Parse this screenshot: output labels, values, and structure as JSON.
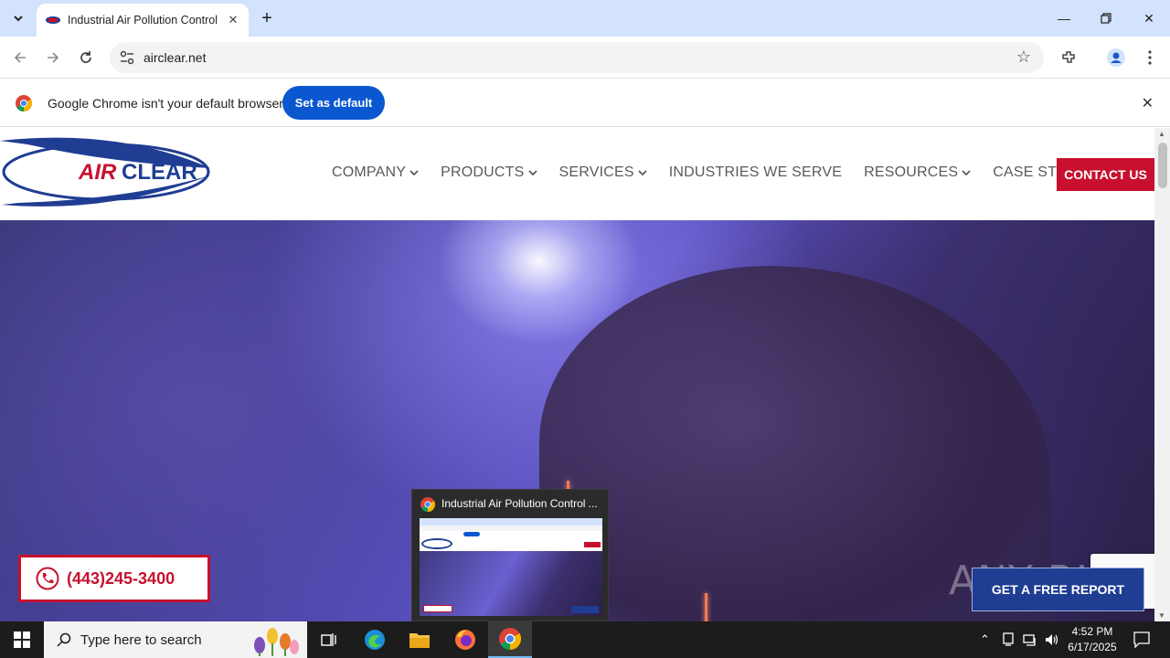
{
  "browser": {
    "tab_title": "Industrial Air Pollution Control",
    "url": "airclear.net"
  },
  "infobar": {
    "message": "Google Chrome isn't your default browser",
    "button": "Set as default"
  },
  "site": {
    "logo_text_air": "AIR",
    "logo_text_clear": "CLEAR",
    "nav": [
      {
        "label": "COMPANY",
        "dropdown": true
      },
      {
        "label": "PRODUCTS",
        "dropdown": true
      },
      {
        "label": "SERVICES",
        "dropdown": true
      },
      {
        "label": "INDUSTRIES WE SERVE",
        "dropdown": false
      },
      {
        "label": "RESOURCES",
        "dropdown": true
      },
      {
        "label": "CASE STUDIES",
        "dropdown": false
      }
    ],
    "contact_button": "CONTACT US",
    "phone": "(443)245-3400",
    "free_report_button": "GET A FREE REPORT",
    "watermark": "ANY RUN"
  },
  "preview": {
    "title": "Industrial Air Pollution Control ..."
  },
  "taskbar": {
    "search_placeholder": "Type here to search",
    "time": "4:52 PM",
    "date": "6/17/2025"
  },
  "colors": {
    "brand_red": "#c8102e",
    "brand_blue": "#1f3d92",
    "chrome_blue": "#0b57d0"
  }
}
